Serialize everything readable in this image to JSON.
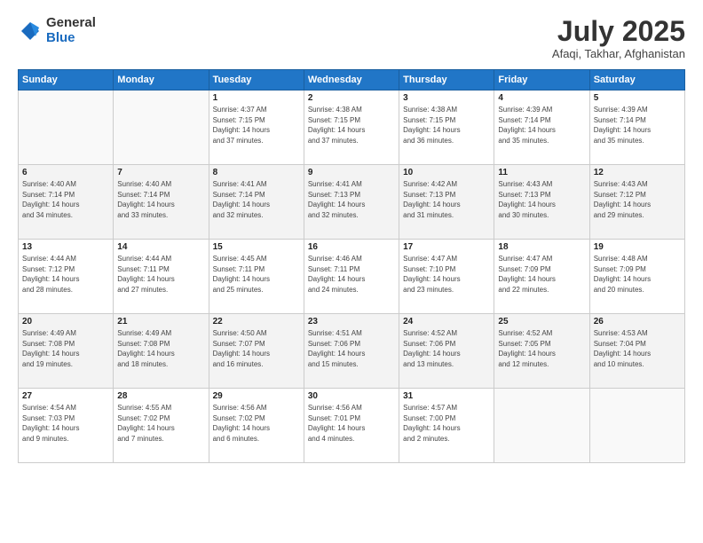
{
  "header": {
    "logo_general": "General",
    "logo_blue": "Blue",
    "title": "July 2025",
    "location": "Afaqi, Takhar, Afghanistan"
  },
  "weekdays": [
    "Sunday",
    "Monday",
    "Tuesday",
    "Wednesday",
    "Thursday",
    "Friday",
    "Saturday"
  ],
  "weeks": [
    [
      {
        "day": "",
        "info": ""
      },
      {
        "day": "",
        "info": ""
      },
      {
        "day": "1",
        "info": "Sunrise: 4:37 AM\nSunset: 7:15 PM\nDaylight: 14 hours\nand 37 minutes."
      },
      {
        "day": "2",
        "info": "Sunrise: 4:38 AM\nSunset: 7:15 PM\nDaylight: 14 hours\nand 37 minutes."
      },
      {
        "day": "3",
        "info": "Sunrise: 4:38 AM\nSunset: 7:15 PM\nDaylight: 14 hours\nand 36 minutes."
      },
      {
        "day": "4",
        "info": "Sunrise: 4:39 AM\nSunset: 7:14 PM\nDaylight: 14 hours\nand 35 minutes."
      },
      {
        "day": "5",
        "info": "Sunrise: 4:39 AM\nSunset: 7:14 PM\nDaylight: 14 hours\nand 35 minutes."
      }
    ],
    [
      {
        "day": "6",
        "info": "Sunrise: 4:40 AM\nSunset: 7:14 PM\nDaylight: 14 hours\nand 34 minutes."
      },
      {
        "day": "7",
        "info": "Sunrise: 4:40 AM\nSunset: 7:14 PM\nDaylight: 14 hours\nand 33 minutes."
      },
      {
        "day": "8",
        "info": "Sunrise: 4:41 AM\nSunset: 7:14 PM\nDaylight: 14 hours\nand 32 minutes."
      },
      {
        "day": "9",
        "info": "Sunrise: 4:41 AM\nSunset: 7:13 PM\nDaylight: 14 hours\nand 32 minutes."
      },
      {
        "day": "10",
        "info": "Sunrise: 4:42 AM\nSunset: 7:13 PM\nDaylight: 14 hours\nand 31 minutes."
      },
      {
        "day": "11",
        "info": "Sunrise: 4:43 AM\nSunset: 7:13 PM\nDaylight: 14 hours\nand 30 minutes."
      },
      {
        "day": "12",
        "info": "Sunrise: 4:43 AM\nSunset: 7:12 PM\nDaylight: 14 hours\nand 29 minutes."
      }
    ],
    [
      {
        "day": "13",
        "info": "Sunrise: 4:44 AM\nSunset: 7:12 PM\nDaylight: 14 hours\nand 28 minutes."
      },
      {
        "day": "14",
        "info": "Sunrise: 4:44 AM\nSunset: 7:11 PM\nDaylight: 14 hours\nand 27 minutes."
      },
      {
        "day": "15",
        "info": "Sunrise: 4:45 AM\nSunset: 7:11 PM\nDaylight: 14 hours\nand 25 minutes."
      },
      {
        "day": "16",
        "info": "Sunrise: 4:46 AM\nSunset: 7:11 PM\nDaylight: 14 hours\nand 24 minutes."
      },
      {
        "day": "17",
        "info": "Sunrise: 4:47 AM\nSunset: 7:10 PM\nDaylight: 14 hours\nand 23 minutes."
      },
      {
        "day": "18",
        "info": "Sunrise: 4:47 AM\nSunset: 7:09 PM\nDaylight: 14 hours\nand 22 minutes."
      },
      {
        "day": "19",
        "info": "Sunrise: 4:48 AM\nSunset: 7:09 PM\nDaylight: 14 hours\nand 20 minutes."
      }
    ],
    [
      {
        "day": "20",
        "info": "Sunrise: 4:49 AM\nSunset: 7:08 PM\nDaylight: 14 hours\nand 19 minutes."
      },
      {
        "day": "21",
        "info": "Sunrise: 4:49 AM\nSunset: 7:08 PM\nDaylight: 14 hours\nand 18 minutes."
      },
      {
        "day": "22",
        "info": "Sunrise: 4:50 AM\nSunset: 7:07 PM\nDaylight: 14 hours\nand 16 minutes."
      },
      {
        "day": "23",
        "info": "Sunrise: 4:51 AM\nSunset: 7:06 PM\nDaylight: 14 hours\nand 15 minutes."
      },
      {
        "day": "24",
        "info": "Sunrise: 4:52 AM\nSunset: 7:06 PM\nDaylight: 14 hours\nand 13 minutes."
      },
      {
        "day": "25",
        "info": "Sunrise: 4:52 AM\nSunset: 7:05 PM\nDaylight: 14 hours\nand 12 minutes."
      },
      {
        "day": "26",
        "info": "Sunrise: 4:53 AM\nSunset: 7:04 PM\nDaylight: 14 hours\nand 10 minutes."
      }
    ],
    [
      {
        "day": "27",
        "info": "Sunrise: 4:54 AM\nSunset: 7:03 PM\nDaylight: 14 hours\nand 9 minutes."
      },
      {
        "day": "28",
        "info": "Sunrise: 4:55 AM\nSunset: 7:02 PM\nDaylight: 14 hours\nand 7 minutes."
      },
      {
        "day": "29",
        "info": "Sunrise: 4:56 AM\nSunset: 7:02 PM\nDaylight: 14 hours\nand 6 minutes."
      },
      {
        "day": "30",
        "info": "Sunrise: 4:56 AM\nSunset: 7:01 PM\nDaylight: 14 hours\nand 4 minutes."
      },
      {
        "day": "31",
        "info": "Sunrise: 4:57 AM\nSunset: 7:00 PM\nDaylight: 14 hours\nand 2 minutes."
      },
      {
        "day": "",
        "info": ""
      },
      {
        "day": "",
        "info": ""
      }
    ]
  ]
}
